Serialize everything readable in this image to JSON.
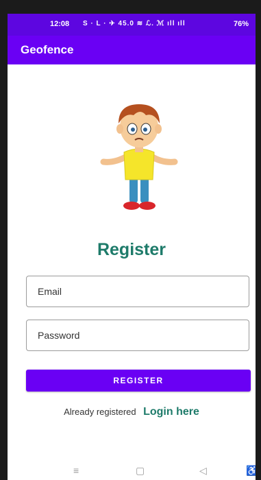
{
  "status_bar": {
    "time": "12:08",
    "icons_text": "S · L · ✈ 45.0 ≋ ℒ. ℳ ıll ıll",
    "battery": "76%"
  },
  "app_bar": {
    "title": "Geofence"
  },
  "illustration": {
    "icon": "confused-boy-illustration"
  },
  "form": {
    "heading": "Register",
    "email_placeholder": "Email",
    "password_placeholder": "Password",
    "register_label": "REGISTER"
  },
  "footer": {
    "note": "Already registered",
    "login_link": "Login here"
  },
  "nav_bar": {
    "menu_icon": "≡",
    "home_icon": "▢",
    "back_icon": "◁",
    "accessibility_icon": "♿"
  },
  "colors": {
    "status_bar": "#5d06e0",
    "app_bar": "#6a00f4",
    "accent_teal": "#1e7b6a",
    "button": "#6a00f4"
  }
}
